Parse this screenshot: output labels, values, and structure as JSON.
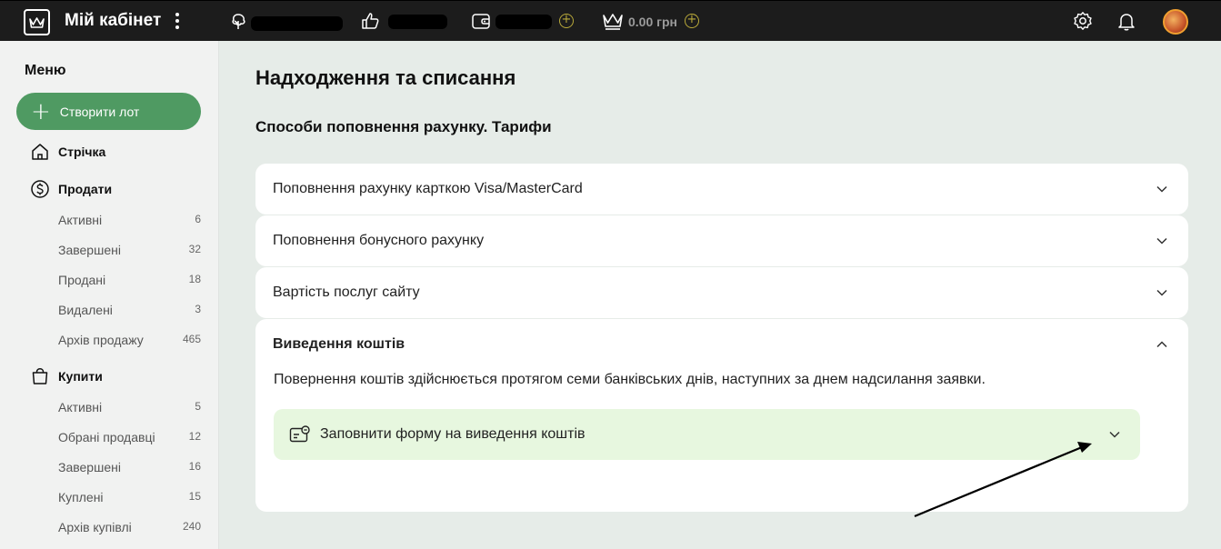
{
  "header": {
    "title": "Мій кабінет",
    "balance": "0.00 грн"
  },
  "sidebar": {
    "menu_title": "Меню",
    "create_button": "Створити лот",
    "feed": "Стрічка",
    "sell": {
      "label": "Продати",
      "items": [
        {
          "label": "Активні",
          "count": "6"
        },
        {
          "label": "Завершені",
          "count": "32"
        },
        {
          "label": "Продані",
          "count": "18"
        },
        {
          "label": "Видалені",
          "count": "3"
        },
        {
          "label": "Архів продажу",
          "count": "465"
        }
      ]
    },
    "buy": {
      "label": "Купити",
      "items": [
        {
          "label": "Активні",
          "count": "5"
        },
        {
          "label": "Обрані продавці",
          "count": "12"
        },
        {
          "label": "Завершені",
          "count": "16"
        },
        {
          "label": "Куплені",
          "count": "15"
        },
        {
          "label": "Архів купівлі",
          "count": "240"
        }
      ]
    }
  },
  "main": {
    "page_title": "Надходження та списання",
    "section_title": "Способи поповнення рахунку. Тарифи",
    "accordions": [
      {
        "label": "Поповнення рахунку карткою Visa/MasterCard"
      },
      {
        "label": "Поповнення бонусного рахунку"
      },
      {
        "label": "Вартість послуг сайту"
      }
    ],
    "open_accordion": {
      "label": "Виведення коштів",
      "text": "Повернення коштів здійснюється протягом семи банківських днів, наступних за днем надсилання заявки.",
      "subpanel_label": "Заповнити форму на виведення коштів"
    }
  },
  "colors": {
    "topbar": "#1c1c1c",
    "accent_green": "#4f9a62",
    "subpanel_bg": "#e7f7df",
    "page_bg": "#e6ece8"
  }
}
